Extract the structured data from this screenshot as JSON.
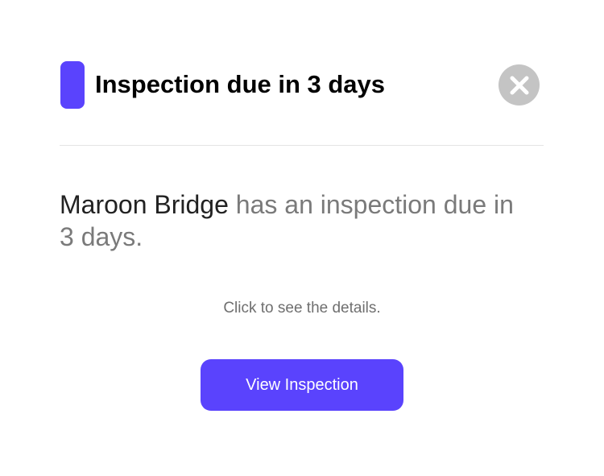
{
  "colors": {
    "accent": "#5a43fd",
    "close_button_bg": "#c4c4c4",
    "close_icon": "#ffffff"
  },
  "header": {
    "title": "Inspection due in 3 days",
    "close_icon": "close-icon"
  },
  "message": {
    "subject": "Maroon Bridge",
    "text": " has an inspection due in 3 days."
  },
  "hint": "Click to see the details.",
  "actions": {
    "primary_label": "View Inspection"
  }
}
